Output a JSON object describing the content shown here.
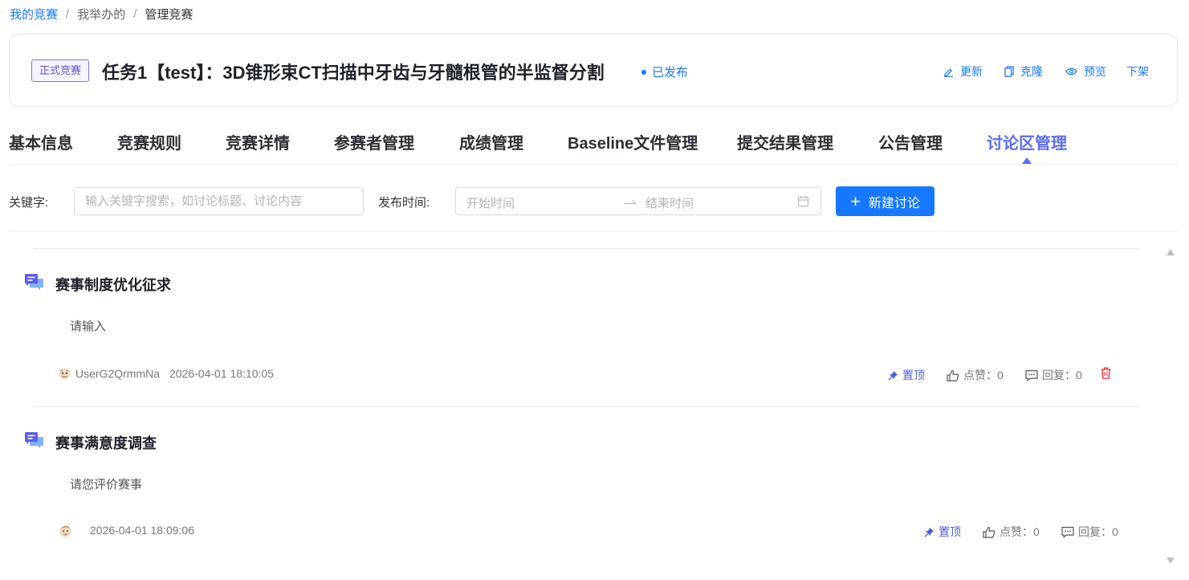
{
  "breadcrumb": {
    "items": [
      "我的竞赛",
      "我举办的",
      "管理竞赛"
    ],
    "separator": "/"
  },
  "header": {
    "tag": "正式竞赛",
    "title": "任务1【test】：3D锥形束CT扫描中牙齿与牙髓根管的半监督分割",
    "status": "已发布",
    "actions": {
      "update": "更新",
      "clone": "克隆",
      "preview": "预览",
      "offline": "下架"
    }
  },
  "tabs": [
    {
      "label": "基本信息"
    },
    {
      "label": "竞赛规则"
    },
    {
      "label": "竞赛详情"
    },
    {
      "label": "参赛者管理"
    },
    {
      "label": "成绩管理"
    },
    {
      "label": "Baseline文件管理"
    },
    {
      "label": "提交结果管理"
    },
    {
      "label": "公告管理"
    },
    {
      "label": "讨论区管理",
      "active": true
    }
  ],
  "filters": {
    "keyword_label": "关键字:",
    "keyword_placeholder": "输入关键字搜索，如讨论标题、讨论内容",
    "time_label": "发布时间:",
    "start_placeholder": "开始时间",
    "end_placeholder": "结束时间",
    "new_button": "新建讨论"
  },
  "discussions": [
    {
      "title": "赛事制度优化征求",
      "content": "请输入",
      "author": "UserG2QrmmNa",
      "time": "2026-04-01 18:10:05",
      "pin_label": "置顶",
      "like_label": "点赞：0",
      "reply_label": "回复：0"
    },
    {
      "title": "赛事满意度调查",
      "content": "请您评价赛事",
      "author": "",
      "time": "2026-04-01 18:09:06",
      "pin_label": "置顶",
      "like_label": "点赞：0",
      "reply_label": "回复：0"
    }
  ],
  "colors": {
    "primary": "#1677ff",
    "active_tab": "#5a6cf0",
    "tag": "#6a4bd8",
    "delete": "#f5222d"
  },
  "icons": [
    "edit-icon",
    "copy-icon",
    "eye-icon",
    "calendar-icon",
    "plus-icon",
    "discussion-icon",
    "pin-icon",
    "thumbs-up-icon",
    "comment-icon",
    "trash-icon"
  ]
}
